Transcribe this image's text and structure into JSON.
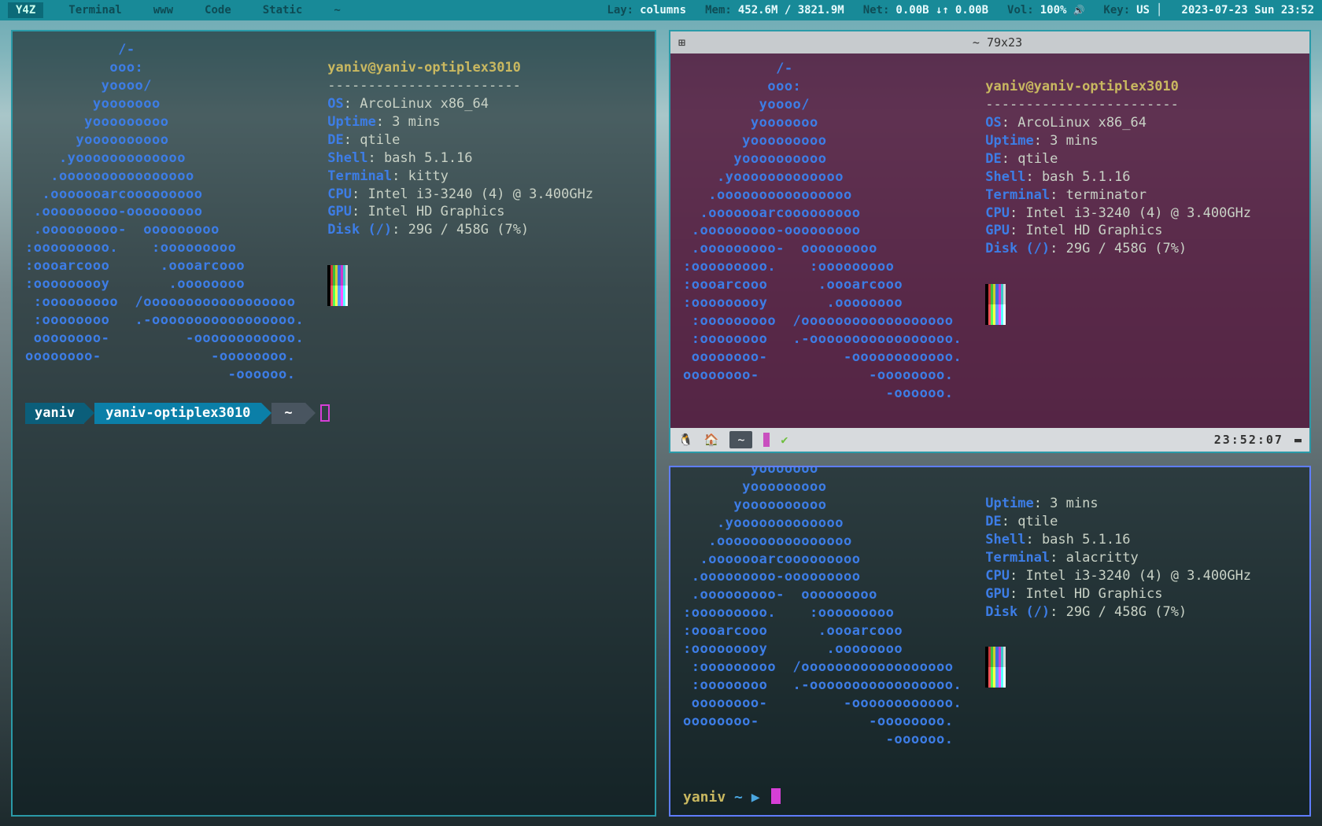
{
  "bar": {
    "workspaces": [
      "Y4Z",
      "Terminal",
      "www",
      "Code",
      "Static",
      "~"
    ],
    "lay_label": "Lay:",
    "lay": "columns",
    "mem_label": "Mem:",
    "mem": "452.6M / 3821.9M",
    "net_label": "Net:",
    "net_down": "0.00B ↓↑",
    "net_up": "0.00B",
    "vol_label": "Vol:",
    "vol": "100%",
    "key_label": "Key:",
    "key": "US",
    "datetime": "2023-07-23 Sun 23:52"
  },
  "ascii_logo": "           /-\n          ooo:\n         yoooo/\n        yooooooo\n       yooooooooo\n      yoooooooooo\n    .yooooooooooooo\n   .oooooooooooooooo\n  .ooooooarcooooooooo\n .ooooooooo-ooooooooo\n .ooooooooo-  ooooooooo\n:ooooooooo.    :ooooooooo\n:oooarcooo      .oooarcooo\n:ooooooooy       .oooooooo\n :ooooooooo  /oooooooooooooooooo\n :oooooooo   .-ooooooooooooooooo.\n oooooooo-         -oooooooooooo.\noooooooo-             -oooooooo.\n                        -oooooo.",
  "user_host": "yaniv@yaniv-optiplex3010",
  "dashes": "------------------------",
  "info_keys": {
    "os": "OS",
    "uptime": "Uptime",
    "de": "DE",
    "shell": "Shell",
    "terminal": "Terminal",
    "cpu": "CPU",
    "gpu": "GPU",
    "disk": "Disk (/)"
  },
  "common": {
    "os": "ArcoLinux x86_64",
    "uptime": "3 mins",
    "de": "qtile",
    "shell": "bash 5.1.16",
    "cpu": "Intel i3-3240 (4) @ 3.400GHz",
    "gpu": "Intel HD Graphics",
    "disk": "29G / 458G (7%)"
  },
  "kitty": {
    "terminal": "kitty",
    "prompt_user": "yaniv",
    "prompt_host": "yaniv-optiplex3010",
    "prompt_cwd": "~"
  },
  "terminator": {
    "title": "~ 79x23",
    "terminal": "terminator",
    "status_cwd": "~",
    "status_time": "23:52:07"
  },
  "alacritty": {
    "terminal": "alacritty",
    "prompt_user": "yaniv",
    "prompt_cwd": "~",
    "prompt_arrow": "▶"
  },
  "swatch_colors": [
    "#000000",
    "#cc3b3b",
    "#3bbf3b",
    "#cccc33",
    "#3b6bdc",
    "#cc3bcc",
    "#3bc9cc",
    "#d8d8d8"
  ]
}
